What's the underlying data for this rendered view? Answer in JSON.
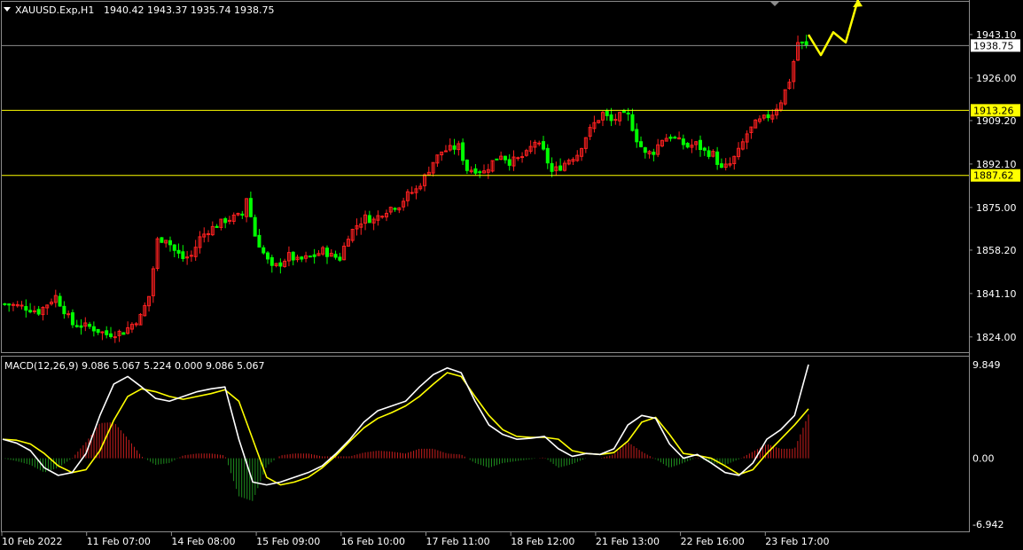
{
  "header": {
    "symbol": "XAUUSD.Exp,H1",
    "ohlc": "1940.42 1943.37 1935.74 1938.75"
  },
  "macd_header": {
    "label": "MACD(12,26,9) 9.086 5.067 5.224 0.000 9.086 5.067"
  },
  "price_axis": {
    "ticks": [
      "1943.10",
      "1926.00",
      "1909.20",
      "1892.10",
      "1875.00",
      "1858.20",
      "1841.10",
      "1824.00"
    ],
    "current_price": "1938.75"
  },
  "levels": [
    {
      "value": "1913.26",
      "color": "#ffff00"
    },
    {
      "value": "1887.62",
      "color": "#ffff00"
    }
  ],
  "macd_axis": {
    "ticks": [
      "9.849",
      "0.00",
      "-6.942"
    ]
  },
  "time_axis": {
    "labels": [
      "10 Feb 2022",
      "11 Feb 07:00",
      "14 Feb 08:00",
      "15 Feb 09:00",
      "16 Feb 10:00",
      "17 Feb 11:00",
      "18 Feb 12:00",
      "21 Feb 13:00",
      "22 Feb 16:00",
      "23 Feb 17:00"
    ]
  },
  "colors": {
    "bull": "#ff2020",
    "bear": "#00ff00",
    "macd_line": "#ffffff",
    "signal_line": "#ffff00",
    "histogram_pos": "#c81e1e",
    "histogram_neg": "#1e8c1e",
    "forecast_arrow": "#ffff00",
    "grid": "#8c8c8c"
  },
  "chart_data": [
    {
      "type": "candlestick",
      "title": "XAUUSD.Exp,H1",
      "ylim": [
        1818,
        1956
      ],
      "x": [
        "10 Feb 2022",
        "11 Feb 07:00",
        "14 Feb 08:00",
        "15 Feb 09:00",
        "16 Feb 10:00",
        "17 Feb 11:00",
        "18 Feb 12:00",
        "21 Feb 13:00",
        "22 Feb 16:00",
        "23 Feb 17:00"
      ],
      "close_path": [
        [
          0,
          1837
        ],
        [
          4,
          1836
        ],
        [
          8,
          1834
        ],
        [
          12,
          1840
        ],
        [
          16,
          1829
        ],
        [
          20,
          1828
        ],
        [
          24,
          1825
        ],
        [
          28,
          1826
        ],
        [
          32,
          1832
        ],
        [
          34,
          1840
        ],
        [
          36,
          1862
        ],
        [
          38,
          1863
        ],
        [
          40,
          1858
        ],
        [
          42,
          1855
        ],
        [
          44,
          1856
        ],
        [
          46,
          1863
        ],
        [
          48,
          1866
        ],
        [
          50,
          1868
        ],
        [
          52,
          1870
        ],
        [
          54,
          1871
        ],
        [
          56,
          1872
        ],
        [
          57,
          1879
        ],
        [
          59,
          1864
        ],
        [
          61,
          1857
        ],
        [
          63,
          1851
        ],
        [
          65,
          1853
        ],
        [
          67,
          1856
        ],
        [
          69,
          1854
        ],
        [
          71,
          1855
        ],
        [
          73,
          1856
        ],
        [
          75,
          1858
        ],
        [
          77,
          1856
        ],
        [
          79,
          1855
        ],
        [
          81,
          1864
        ],
        [
          83,
          1868
        ],
        [
          85,
          1871
        ],
        [
          87,
          1870
        ],
        [
          89,
          1873
        ],
        [
          91,
          1875
        ],
        [
          93,
          1876
        ],
        [
          95,
          1880
        ],
        [
          97,
          1882
        ],
        [
          99,
          1887
        ],
        [
          101,
          1893
        ],
        [
          103,
          1897
        ],
        [
          105,
          1898
        ],
        [
          107,
          1899
        ],
        [
          109,
          1890
        ],
        [
          111,
          1890
        ],
        [
          113,
          1889
        ],
        [
          115,
          1893
        ],
        [
          117,
          1896
        ],
        [
          119,
          1893
        ],
        [
          121,
          1894
        ],
        [
          123,
          1896
        ],
        [
          125,
          1901
        ],
        [
          127,
          1897
        ],
        [
          129,
          1889
        ],
        [
          131,
          1891
        ],
        [
          133,
          1894
        ],
        [
          135,
          1896
        ],
        [
          137,
          1903
        ],
        [
          139,
          1908
        ],
        [
          141,
          1912
        ],
        [
          143,
          1909
        ],
        [
          145,
          1911
        ],
        [
          147,
          1911
        ],
        [
          149,
          1902
        ],
        [
          151,
          1896
        ],
        [
          153,
          1897
        ],
        [
          155,
          1902
        ],
        [
          157,
          1903
        ],
        [
          159,
          1901
        ],
        [
          161,
          1899
        ],
        [
          163,
          1900
        ],
        [
          165,
          1897
        ],
        [
          167,
          1896
        ],
        [
          169,
          1890
        ],
        [
          171,
          1892
        ],
        [
          173,
          1897
        ],
        [
          175,
          1904
        ],
        [
          177,
          1908
        ],
        [
          179,
          1910
        ],
        [
          181,
          1912
        ],
        [
          183,
          1917
        ],
        [
          185,
          1925
        ],
        [
          187,
          1940
        ],
        [
          189,
          1938.75
        ]
      ],
      "current": 1938.75,
      "levels": [
        1913.26,
        1887.62
      ],
      "forecast": [
        [
          0,
          1943
        ],
        [
          1,
          1935
        ],
        [
          2,
          1944
        ],
        [
          3,
          1940
        ],
        [
          4,
          1957
        ]
      ]
    },
    {
      "type": "line",
      "title": "MACD(12,26,9)",
      "ylim": [
        -6.942,
        9.849
      ],
      "series": [
        {
          "name": "MACD",
          "values": [
            2,
            1.6,
            0.8,
            -1.0,
            -1.8,
            -1.5,
            0.5,
            4.5,
            7.8,
            8.6,
            7.5,
            6.3,
            6.0,
            6.5,
            7.0,
            7.3,
            7.5,
            2.0,
            -2.5,
            -2.8,
            -2.5,
            -2.0,
            -1.5,
            -0.8,
            0.5,
            2.0,
            3.8,
            5.0,
            5.5,
            6.0,
            7.5,
            8.8,
            9.5,
            9.0,
            6.0,
            3.5,
            2.5,
            2.0,
            2.1,
            2.3,
            1.0,
            0.2,
            0.5,
            0.4,
            1.0,
            3.5,
            4.5,
            4.2,
            1.5,
            0.0,
            0.4,
            -0.5,
            -1.5,
            -1.8,
            -0.5,
            2.0,
            3.0,
            4.5,
            9.849
          ],
          "color": "#ffffff"
        },
        {
          "name": "Signal",
          "values": [
            2,
            1.9,
            1.5,
            0.5,
            -0.8,
            -1.5,
            -1.2,
            0.8,
            4.0,
            6.5,
            7.3,
            7.0,
            6.5,
            6.2,
            6.5,
            6.8,
            7.2,
            6.0,
            2.0,
            -2.0,
            -2.8,
            -2.5,
            -2.0,
            -1.0,
            0.3,
            1.8,
            3.2,
            4.2,
            4.8,
            5.5,
            6.5,
            7.8,
            9.0,
            8.6,
            6.5,
            4.5,
            3.0,
            2.3,
            2.2,
            2.2,
            2.0,
            0.8,
            0.5,
            0.4,
            0.6,
            1.8,
            3.8,
            4.3,
            2.5,
            0.5,
            0.3,
            0.0,
            -0.8,
            -1.7,
            -1.2,
            0.5,
            2.0,
            3.5,
            5.2
          ],
          "color": "#ffff00"
        },
        {
          "name": "Histogram",
          "values": [
            0,
            -0.3,
            -0.7,
            -1.5,
            -1.0,
            0.0,
            1.7,
            3.7,
            3.8,
            2.1,
            0.2,
            -0.7,
            -0.5,
            0.3,
            0.5,
            0.5,
            0.3,
            -4.0,
            -4.5,
            -0.8,
            0.3,
            0.5,
            0.5,
            0.2,
            0.2,
            0.2,
            0.6,
            0.8,
            0.7,
            0.5,
            1.0,
            1.0,
            0.5,
            0.4,
            -0.5,
            -1.0,
            -0.5,
            -0.3,
            -0.1,
            0.1,
            -1.0,
            -0.6,
            0.0,
            0.0,
            0.4,
            1.7,
            0.7,
            -0.1,
            -1.0,
            -0.5,
            0.1,
            -0.5,
            -0.7,
            -0.1,
            0.7,
            1.5,
            1.0,
            1.0,
            4.6
          ],
          "color": "#c81e1e"
        }
      ]
    }
  ]
}
